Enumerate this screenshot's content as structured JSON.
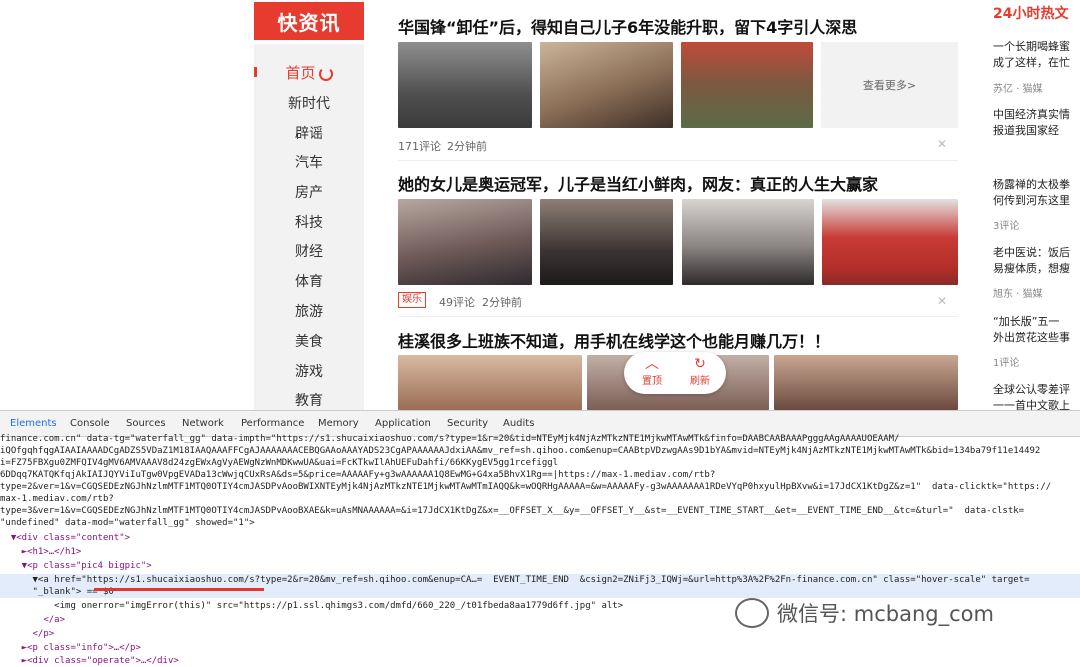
{
  "site": {
    "logo": "快资讯",
    "nav": [
      "首页",
      "新时代",
      "辟谣",
      "汽车",
      "房产",
      "科技",
      "财经",
      "体育",
      "旅游",
      "美食",
      "游戏",
      "教育"
    ]
  },
  "feed": [
    {
      "title": "华国锋“卸任”后，得知自己儿子6年没能升职，留下4字引人深思",
      "comments": "171评论",
      "time": "2分钟前",
      "more": "查看更多>"
    },
    {
      "title": "她的女儿是奥运冠军，儿子是当红小鲜肉，网友：真正的人生大赢家",
      "tag": "娱乐",
      "comments": "49评论",
      "time": "2分钟前"
    },
    {
      "title": "桂溪很多上班族不知道，用手机在线学这个也能月赚几万！！"
    }
  ],
  "float": {
    "top": "置顶",
    "refresh": "刷新"
  },
  "hot": {
    "title": "24小时热文",
    "items": [
      {
        "lines": [
          "一个长期喝蜂蜜",
          "成了这样，在忙"
        ],
        "meta": "苏亿 · 猫媒"
      },
      {
        "lines": [
          "中国经济真实情",
          "报道我国家经"
        ],
        "meta": ""
      },
      {
        "lines": [
          "杨露禅的太极拳",
          "何传到河东这里"
        ],
        "meta": "3评论"
      },
      {
        "lines": [
          "老中医说：饭后",
          "易瘦体质，想瘦"
        ],
        "meta": "旭东 · 猫媒"
      },
      {
        "lines": [
          "“加长版”五一",
          "外出赏花这些事"
        ],
        "meta": "1评论"
      },
      {
        "lines": [
          "全球公认零差评",
          "一一首中文歌上"
        ],
        "meta": ""
      }
    ]
  },
  "devtools": {
    "tabs": [
      "Elements",
      "Console",
      "Sources",
      "Network",
      "Performance",
      "Memory",
      "Application",
      "Security",
      "Audits"
    ],
    "lines": [
      "finance.com.cn\" data-tg=\"waterfall_gg\" data-impth=\"https://s1.shucaixiaoshuo.com/s?type=1&r=20&tid=NTEyMjk4NjAzMTkzNTE1MjkwMTAwMTk&finfo=DAABCAABAAAPgggAAgAAAAUOEAAM/",
      "iQOfgqhfqgAIAAIAAAADCgADZS5VDaZ1M18IAAQAAAFFCgAJAAAAAAACEBQGAAoAAAYADS23CgAPAAAAAAJdxiAA&mv_ref=sh.qihoo.com&enup=CAABtpVDzwgAAs9D1bYA&mvid=NTEyMjk4NjAzMTkzNTE1MjkwMTAwMTk&bid=134ba79f11e14492",
      "i=FZ75FBXgu0ZMFQIV4gMV6AMVAAAV8d24zgEWxAgVyAEWgNzWnMDKwwUA&uai=FcKTkwIlAhUEFuDahfi/66KKygEV5gg1rcefiggl",
      "6DDqq7KATQKfqjAkIAIJQYViIuTgw0VpgEVADa13cWwjqCUxRsA&ds=5&price=AAAAAFy+g3wAAAAAA1Q8EwMG+G4xa5BhvX1Rg==|https://max-1.mediav.com/rtb?",
      "type=2&ver=1&v=CGQSEDEzNGJhNzlmMTF1MTQ0OTIY4cmJASDPvAooBWIXNTEyMjk4NjAzMTkzNTE1MjkwMTAwMTmIAQQ&k=wOQRHgAAAAA=&w=AAAAAFy-g3wAAAAAAA1RDeVYqP0hxyulHpBXvw&i=17JdCX1KtDgZ&z=1\"  data-clicktk=\"https://",
      "max-1.mediav.com/rtb?",
      "type=3&ver=1&v=CGQSEDEzNGJhNzlmMTF1MTQ0OTIY4cmJASDPvAooBXAE&k=uAsMNAAAAAA=&i=17JdCX1KtDgZ&x=__OFFSET_X__&y=__OFFSET_Y__&st=__EVENT_TIME_START__&et=__EVENT_TIME_END__&tc=&turl=\"  data-clstk=",
      "\"undefined\" data-mod=\"waterfall_gg\" showed=\"1\">",
      "  ▼<div class=\"content\">",
      "    ►<h1>…</h1>",
      "    ▼<p class=\"pic4 bigpic\">",
      "      ▼<a href=\"https://s1.shucaixiaoshuo.com/s?type=2&r=20&mv_ref=sh.qihoo.com&enup=CA…=  EVENT_TIME_END  &csign2=ZNiFj3_IQWj=&url=http%3A%2F%2Fn-finance.com.cn\" class=\"hover-scale\" target=",
      "      \"_blank\"> == $0",
      "          <img onerror=\"imgError(this)\" src=\"https://p1.ssl.qhimgs3.com/dmfd/660_220_/t01fbeda8aa1779d6ff.jpg\" alt>",
      "        </a>",
      "      </p>",
      "    ►<p class=\"info\">…</p>",
      "    ►<div class=\"operate\">…</div>"
    ]
  },
  "watermark": "微信号: mcbang_com",
  "colors": {
    "accent": "#e63b2e",
    "devtools_selection": "#e3ecfa"
  }
}
